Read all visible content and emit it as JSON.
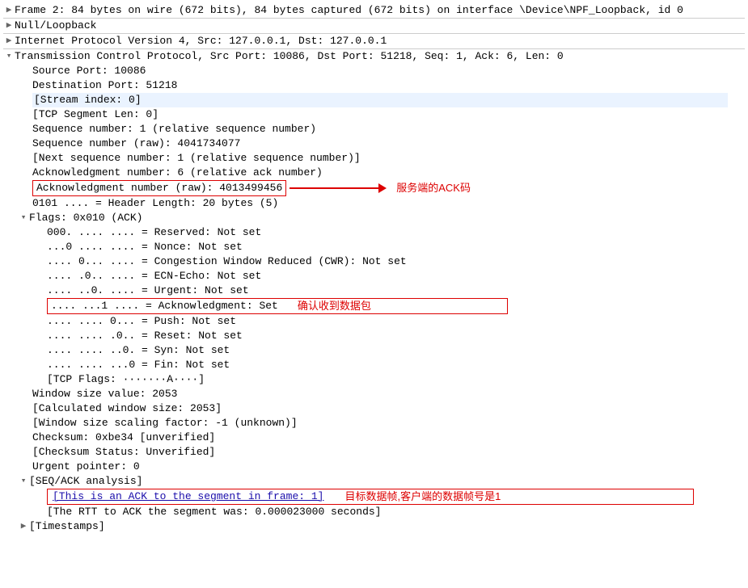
{
  "frame": "Frame 2: 84 bytes on wire (672 bits), 84 bytes captured (672 bits) on interface \\Device\\NPF_Loopback, id 0",
  "null_loopback": "Null/Loopback",
  "ipv4": "Internet Protocol Version 4, Src: 127.0.0.1, Dst: 127.0.0.1",
  "tcp_header": "Transmission Control Protocol, Src Port: 10086, Dst Port: 51218, Seq: 1, Ack: 6, Len: 0",
  "tcp": {
    "src_port": "Source Port: 10086",
    "dst_port": "Destination Port: 51218",
    "stream_index": "[Stream index: 0]",
    "seg_len": "[TCP Segment Len: 0]",
    "seq_rel": "Sequence number: 1    (relative sequence number)",
    "seq_raw": "Sequence number (raw): 4041734077",
    "next_seq": "[Next sequence number: 1    (relative sequence number)]",
    "ack_rel": "Acknowledgment number: 6    (relative ack number)",
    "ack_raw": "Acknowledgment number (raw): 4013499456",
    "hdr_len": "0101 .... = Header Length: 20 bytes (5)",
    "flags_header": "Flags: 0x010 (ACK)",
    "flags": {
      "reserved": "000. .... .... = Reserved: Not set",
      "nonce": "...0 .... .... = Nonce: Not set",
      "cwr": ".... 0... .... = Congestion Window Reduced (CWR): Not set",
      "ecn": ".... .0.. .... = ECN-Echo: Not set",
      "urg": ".... ..0. .... = Urgent: Not set",
      "ack": ".... ...1 .... = Acknowledgment: Set",
      "push": ".... .... 0... = Push: Not set",
      "reset": ".... .... .0.. = Reset: Not set",
      "syn": ".... .... ..0. = Syn: Not set",
      "fin": ".... .... ...0 = Fin: Not set",
      "tcp_flags": "[TCP Flags: ·······A····]"
    },
    "win_size": "Window size value: 2053",
    "calc_win": "[Calculated window size: 2053]",
    "scale": "[Window size scaling factor: -1 (unknown)]",
    "checksum": "Checksum: 0xbe34 [unverified]",
    "checksum_status": "[Checksum Status: Unverified]",
    "urgent": "Urgent pointer: 0",
    "seq_ack": "[SEQ/ACK analysis]",
    "ack_to_frame": "[This is an ACK to the segment in frame: 1]",
    "rtt": "[The RTT to ACK the segment was: 0.000023000 seconds]",
    "timestamps": "[Timestamps]"
  },
  "annotations": {
    "ack_raw": "服务端的ACK码",
    "ack_flag": "确认收到数据包",
    "ack_to_frame": "目标数据帧,客户端的数据帧号是1"
  }
}
